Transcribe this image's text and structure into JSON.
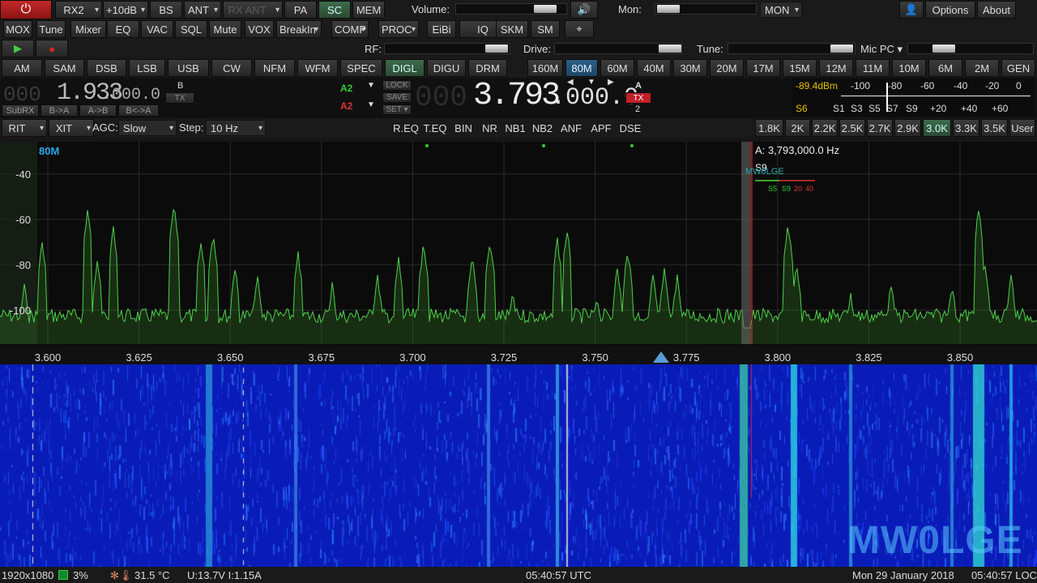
{
  "row1": {
    "rx2": "RX2",
    "preamp": "+10dB",
    "bs": "BS",
    "ant": "ANT",
    "rxant": "RX ANT",
    "pa": "PA",
    "sc": "SC",
    "mem": "MEM",
    "volume": "Volume:",
    "mon": "Mon:",
    "mon_select": "MON",
    "options": "Options",
    "about": "About"
  },
  "row2": {
    "moxs": [
      "MOX",
      "Tune",
      "Mixer",
      "EQ",
      "VAC",
      "SQL",
      "Mute",
      "VOX",
      "BreakIn",
      "COMP",
      "PROC",
      "EiBi",
      "IQ",
      "SKM",
      "SM"
    ]
  },
  "row3": {
    "rf": "RF:",
    "drive": "Drive:",
    "tune": "Tune:",
    "micpc": "Mic PC"
  },
  "modes": [
    "AM",
    "SAM",
    "DSB",
    "LSB",
    "USB",
    "CW",
    "NFM",
    "WFM",
    "SPEC",
    "DIGL",
    "DIGU",
    "DRM"
  ],
  "bands": [
    "160M",
    "80M",
    "60M",
    "40M",
    "30M",
    "20M",
    "17M",
    "15M",
    "12M",
    "11M",
    "10M",
    "6M",
    "2M",
    "GEN"
  ],
  "vfob": {
    "label": "B",
    "tx": "TX",
    "freq_dim": "000",
    "freq_main": "1.933",
    "freq_sub": ".000.0",
    "subrx": "SubRX",
    "btoa": "B->A",
    "atob": "A->B",
    "swap": "B<->A"
  },
  "center": {
    "a2_top": "A2",
    "a2_bot": "A2",
    "lock": "LOCK",
    "save": "SAVE",
    "set": "SET"
  },
  "vfoa": {
    "freq_dim": "000",
    "freq_main": "3.793",
    "freq_sub": ".000.0",
    "label": "A",
    "tx": "TX",
    "rx": "2"
  },
  "meter": {
    "dbm": "-89.4dBm",
    "s_reading": "S6",
    "top_scale": [
      "-100",
      "-80",
      "-60",
      "-40",
      "-20",
      "0"
    ],
    "bot_scale": [
      "S1",
      "S3",
      "S5",
      "S7",
      "S9",
      "+20",
      "+40",
      "+60"
    ]
  },
  "row5": {
    "rit": "RIT",
    "xit": "XIT",
    "agc_label": "AGC:",
    "agc_value": "Slow",
    "step_label": "Step:",
    "step_value": "10 Hz",
    "dsp": [
      "R.EQ",
      "T.EQ",
      "BIN",
      "NR",
      "NB1",
      "NB2",
      "ANF",
      "APF",
      "DSE"
    ],
    "filters": [
      "1.8K",
      "2K",
      "2.2K",
      "2.5K",
      "2.7K",
      "2.9K",
      "3.0K",
      "3.3K",
      "3.5K",
      "User"
    ]
  },
  "pan": {
    "band": "80M",
    "readout": "A: 3,793,000.0 Hz",
    "dbticks": [
      "-40",
      "-60",
      "-80",
      "-100"
    ],
    "freqticks": [
      "3.600",
      "3.625",
      "3.650",
      "3.675",
      "3.700",
      "3.725",
      "3.750",
      "3.775",
      "3.800",
      "3.825",
      "3.850"
    ],
    "smeter_label": "S9",
    "callsign_small": "MW0LGE",
    "smeter_scale": [
      "S5",
      "S9",
      "20",
      "40"
    ]
  },
  "watermark": "MW0LGE",
  "status": {
    "res": "1920x1080",
    "cpu": "3%",
    "temp": "31.5 °C",
    "volt": "U:13.7V I:1.15A",
    "utc": "05:40:57 UTC",
    "date": "Mon 29 January 2018",
    "loc": "05:40:57 LOC"
  },
  "colors": {
    "accent": "#2e5f86",
    "spectrum": "#4cd04c",
    "vfo_text": "#e8e8e8",
    "tx_red": "#c0202a"
  }
}
